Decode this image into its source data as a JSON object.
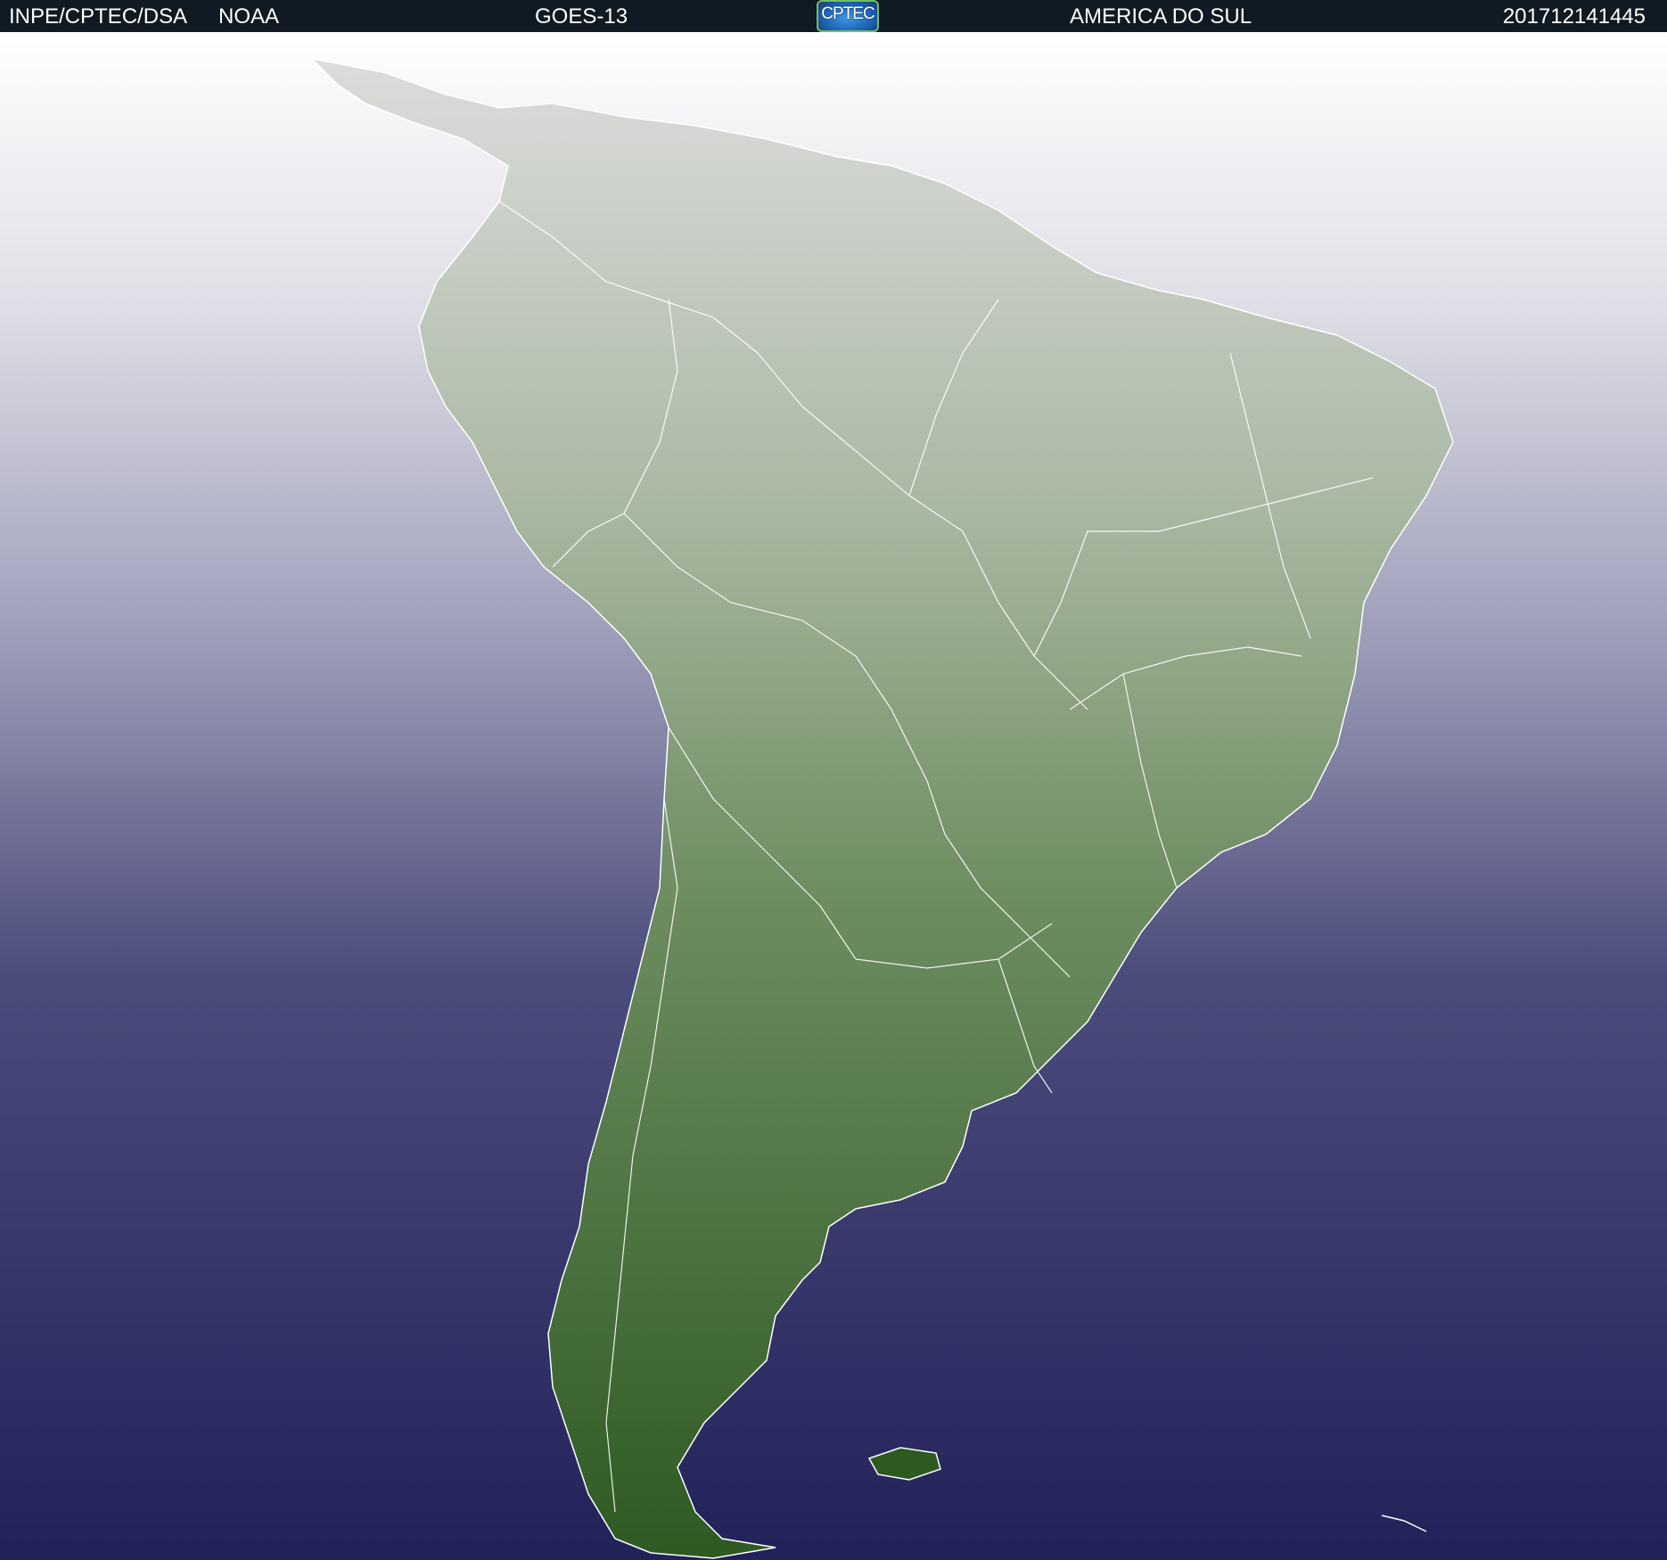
{
  "header": {
    "institution": "INPE/CPTEC/DSA",
    "agency": "NOAA",
    "satellite": "GOES-13",
    "logo_text": "CPTEC",
    "region": "AMERICA DO SUL",
    "timestamp": "201712141445"
  },
  "colors": {
    "header_bg": "#101a24",
    "header_text": "#ffffff",
    "ocean": "#23235a",
    "cloud": "#e8e8e8",
    "land": "#2f5a23",
    "borders": "#ffffff"
  }
}
